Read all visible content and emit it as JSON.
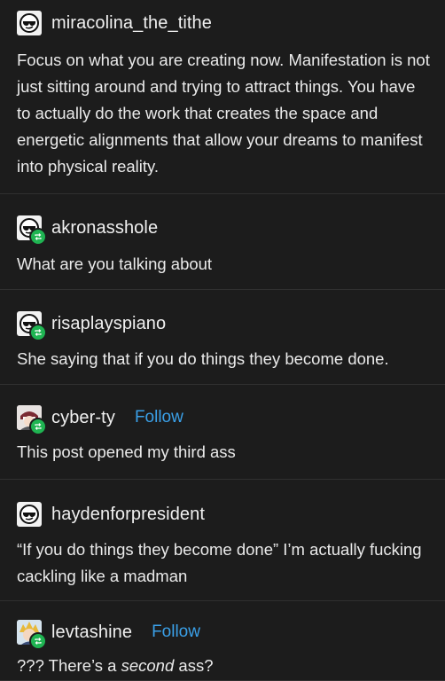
{
  "posts": [
    {
      "username": "miracolina_the_tithe",
      "text": "Focus on what you are creating now. Manifestation is not just sitting around and trying to attract things. You have to actually do the work that creates the space and energetic alignments that allow your dreams to manifest into physical reality."
    },
    {
      "username": "akronasshole",
      "text": "What are you talking about"
    },
    {
      "username": "risaplayspiano",
      "text": "She saying that if you do things they become done."
    },
    {
      "username": "cyber-ty",
      "follow": "Follow",
      "text": "This post opened my third ass"
    },
    {
      "username": "haydenforpresident",
      "text": "“If you do things they become done” I’m actually fucking cackling like a madman"
    },
    {
      "username": "levtashine",
      "follow": "Follow",
      "text_before": "??? There’s a ",
      "text_em": "second",
      "text_after": " ass?"
    }
  ],
  "colors": {
    "background": "#1c1c1c",
    "divider": "#303030",
    "link": "#3aa0e8",
    "reblog": "#1fb452"
  },
  "icons": [
    "sunglasses-avatar-icon",
    "reblog-icon",
    "anime-avatar-icon"
  ]
}
